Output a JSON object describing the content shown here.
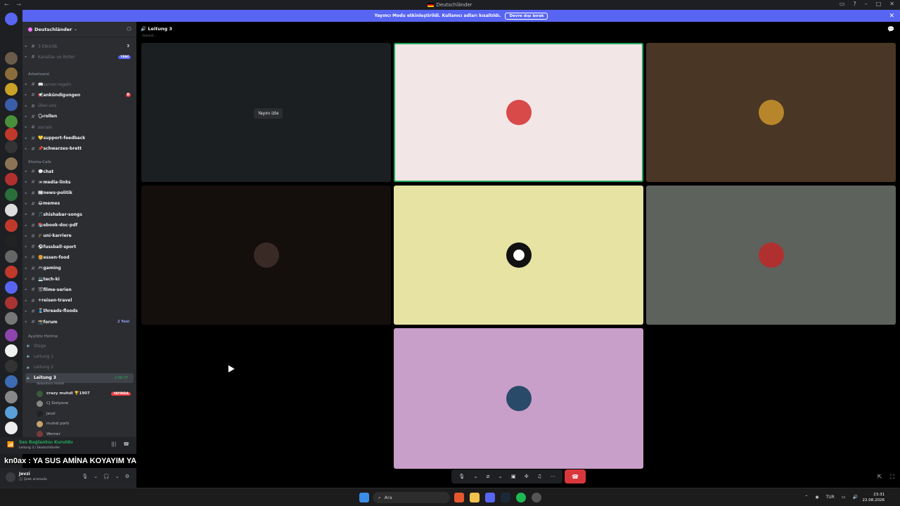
{
  "window": {
    "title": "Deutschländer"
  },
  "banner": {
    "text": "Yayıncı Modu etkinleştirildi. Kullanıcı adları kısaltıldı.",
    "button": "Devre dışı bırak"
  },
  "server": {
    "name": "Deutschländer"
  },
  "top_items": [
    {
      "label": "3 Etkinlik",
      "count": "3"
    },
    {
      "label": "Kanallar ve Roller",
      "badge": "YENİ"
    }
  ],
  "categories": {
    "arbeitsamt": "Arbeitsamt",
    "shisha": "Shisha-Cafe",
    "hotline": "Ayyildiz Hotline"
  },
  "channels_a": [
    {
      "label": "📖server-regeln",
      "style": "muted"
    },
    {
      "label": "📢ankündigungen",
      "style": "unread",
      "count": "8"
    },
    {
      "label": "über-uns",
      "style": "muted"
    },
    {
      "label": "🗣rollen",
      "style": "unread"
    },
    {
      "label": "socials",
      "style": "muted"
    },
    {
      "label": "💛support-feedback",
      "style": "unread"
    },
    {
      "label": "📌schwarzes-brett",
      "style": "unread"
    }
  ],
  "channels_b": [
    {
      "label": "💬chat"
    },
    {
      "label": "📼media-links"
    },
    {
      "label": "📰news-politik"
    },
    {
      "label": "😂memes"
    },
    {
      "label": "🎵shishabar-songs"
    },
    {
      "label": "📚ebook-doc-pdf"
    },
    {
      "label": "🎓uni-karriere"
    },
    {
      "label": "⚽fussball-sport"
    },
    {
      "label": "🍔essen-food"
    },
    {
      "label": "🎮gaming"
    },
    {
      "label": "💻tech-ki"
    },
    {
      "label": "🎬filme-serien"
    },
    {
      "label": "✈reisen-travel"
    },
    {
      "label": "🧵threads-floods"
    },
    {
      "label": "📸forum",
      "count": "2 Yeni"
    }
  ],
  "voice_channels": [
    {
      "label": "Stage"
    },
    {
      "label": "Leitung 1"
    },
    {
      "label": "Leitung 2"
    },
    {
      "label": "Leitung 3",
      "timer": "2:08:37",
      "subtitle": "dolandırıcı muhdi"
    }
  ],
  "voice_users": [
    {
      "name": "crazy muhdi 🏆1907",
      "live": "YAYINDA"
    },
    {
      "name": "CJ Sixtyone"
    },
    {
      "name": "Jevzi"
    },
    {
      "name": "muhdi porti"
    },
    {
      "name": "Werner"
    }
  ],
  "voice_status": {
    "title": "Ses Bağlantısı Kuruldu",
    "channel": "Leitung 3 / Deutschländer"
  },
  "user": {
    "name": "Jevzi",
    "status": "🎧 Şeek aramada"
  },
  "caption": "kn0ax : YA SUS AMİNA KOYAYIM YA",
  "stage": {
    "title": "Leitung 3",
    "subtitle": "dolandı...",
    "watch_button": "Yayını izle"
  },
  "tiles": [
    {
      "bg": "#1b1f21"
    },
    {
      "bg": "#f3e6e6",
      "speaking": true
    },
    {
      "bg": "#4a3625"
    },
    {
      "bg": "#140f0d"
    },
    {
      "bg": "#e6e3a3"
    },
    {
      "bg": "#5d625c"
    },
    {
      "bg": "#c89fc9"
    }
  ],
  "taskbar": {
    "search": "Ara",
    "lang": "TUR",
    "time": "23:31",
    "date": "22.08.2026"
  },
  "colors": {
    "accent": "#5865f2",
    "danger": "#da373c",
    "online": "#23a55a"
  }
}
